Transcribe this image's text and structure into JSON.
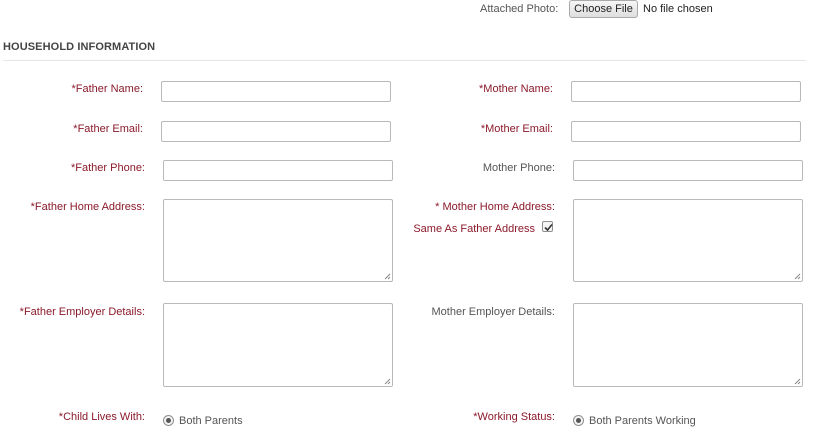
{
  "photo": {
    "label": "Attached Photo:",
    "button_label": "Choose File",
    "status": "No file chosen"
  },
  "section": {
    "title": "HOUSEHOLD INFORMATION"
  },
  "father": {
    "name_label": "*Father Name:",
    "email_label": "*Father Email:",
    "phone_label": "*Father Phone:",
    "address_label": "*Father Home Address:",
    "employer_label": "*Father Employer Details:"
  },
  "mother": {
    "name_label": "*Mother Name:",
    "email_label": "*Mother Email:",
    "phone_label": "Mother Phone:",
    "address_label": "* Mother Home Address:",
    "same_as_label": "Same As Father Address",
    "same_as_checked": true,
    "employer_label": "Mother Employer Details:"
  },
  "child_lives_with": {
    "label": "*Child Lives With:",
    "selected": "Both Parents"
  },
  "working_status": {
    "label": "*Working Status:",
    "selected": "Both Parents Working"
  },
  "colors": {
    "required_label": "#8b1a2b",
    "label": "#555555"
  }
}
